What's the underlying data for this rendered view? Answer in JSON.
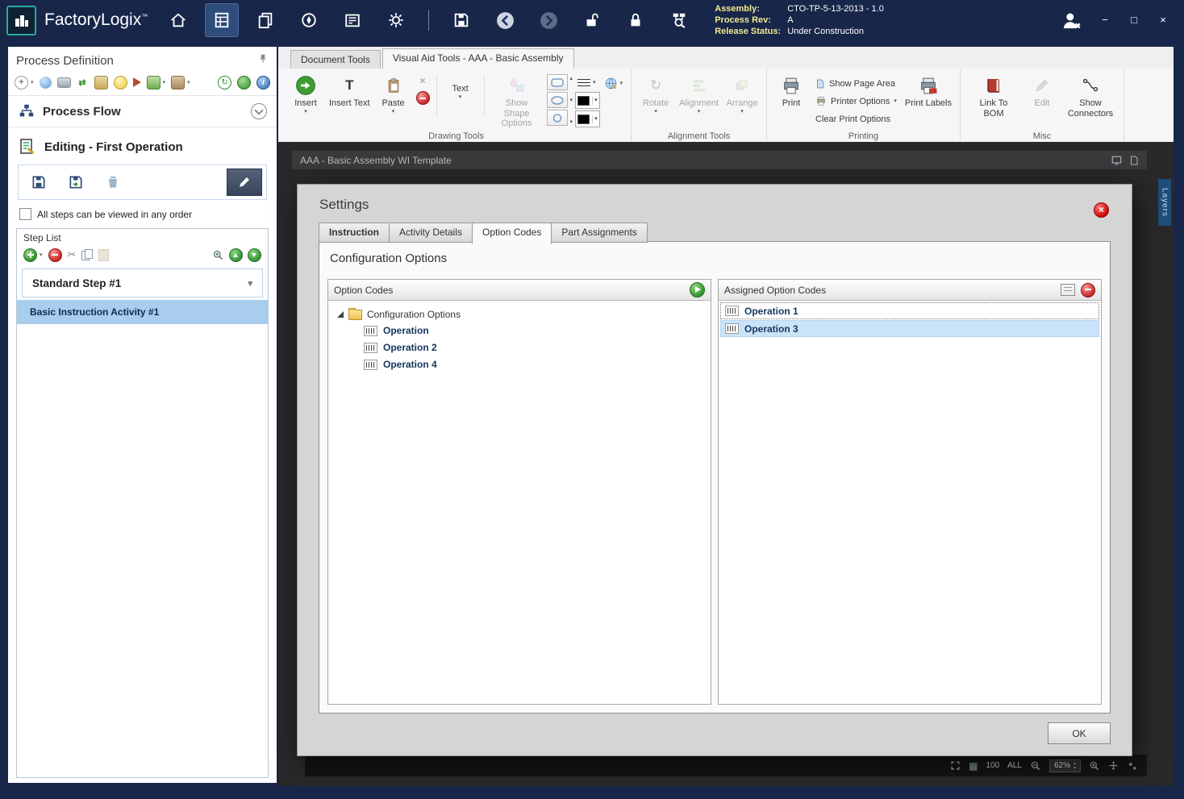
{
  "icons": {
    "caret": "▾",
    "caret_small": "▼",
    "spinner_up": "▴",
    "spinner_down": "▾",
    "scissors": "✂",
    "rotate": "↻",
    "swap": "⇄",
    "grid": "▦",
    "text_tool": "T",
    "info": "i",
    "plus": "+",
    "x": "×",
    "tm": "™",
    "minimize": "−",
    "maximize": "□",
    "close": "×"
  },
  "titlebar": {
    "app_name": "FactoryLogix",
    "info": {
      "assembly_label": "Assembly:",
      "assembly_value": "CTO-TP-5-13-2013 - 1.0",
      "process_rev_label": "Process Rev:",
      "process_rev_value": "A",
      "release_status_label": "Release Status:",
      "release_status_value": "Under Construction"
    }
  },
  "sidebar": {
    "title": "Process Definition",
    "process_flow": "Process Flow",
    "editing_title": "Editing - First Operation",
    "order_checkbox_label": "All steps can be viewed in any order",
    "step_list": {
      "title": "Step List",
      "step_name": "Standard Step #1",
      "activity_name": "Basic Instruction Activity #1"
    }
  },
  "ribbon": {
    "tabs": [
      "Document Tools",
      "Visual Aid Tools - AAA - Basic Assembly"
    ],
    "drawing": {
      "group_label": "Drawing Tools",
      "insert": "Insert",
      "insert_text": "Insert Text",
      "paste": "Paste",
      "text": "Text",
      "show_shape_options": "Show Shape Options"
    },
    "alignment": {
      "group_label": "Alignment Tools",
      "rotate": "Rotate",
      "alignment": "Alignment",
      "arrange": "Arrange"
    },
    "printing": {
      "group_label": "Printing",
      "print": "Print",
      "show_page_area": "Show Page Area",
      "printer_options": "Printer Options",
      "clear_print_options": "Clear Print Options",
      "print_labels": "Print Labels"
    },
    "misc": {
      "group_label": "Misc",
      "link_to_bom": "Link To BOM",
      "edit": "Edit",
      "show_connectors": "Show Connectors"
    }
  },
  "canvas": {
    "doc_title": "AAA - Basic Assembly WI Template",
    "layers_label": "Layers"
  },
  "statusbar": {
    "page": "100",
    "all": "ALL",
    "zoom": "62%"
  },
  "dialog": {
    "title": "Settings",
    "tabs": [
      "Instruction",
      "Activity Details",
      "Option Codes",
      "Part Assignments"
    ],
    "section_title": "Configuration Options",
    "left_panel": {
      "header": "Option Codes",
      "root": "Configuration Options",
      "items": [
        "Operation",
        "Operation 2",
        "Operation 4"
      ]
    },
    "right_panel": {
      "header": "Assigned Option Codes",
      "items": [
        "Operation 1",
        "Operation 3"
      ]
    },
    "ok_label": "OK"
  }
}
